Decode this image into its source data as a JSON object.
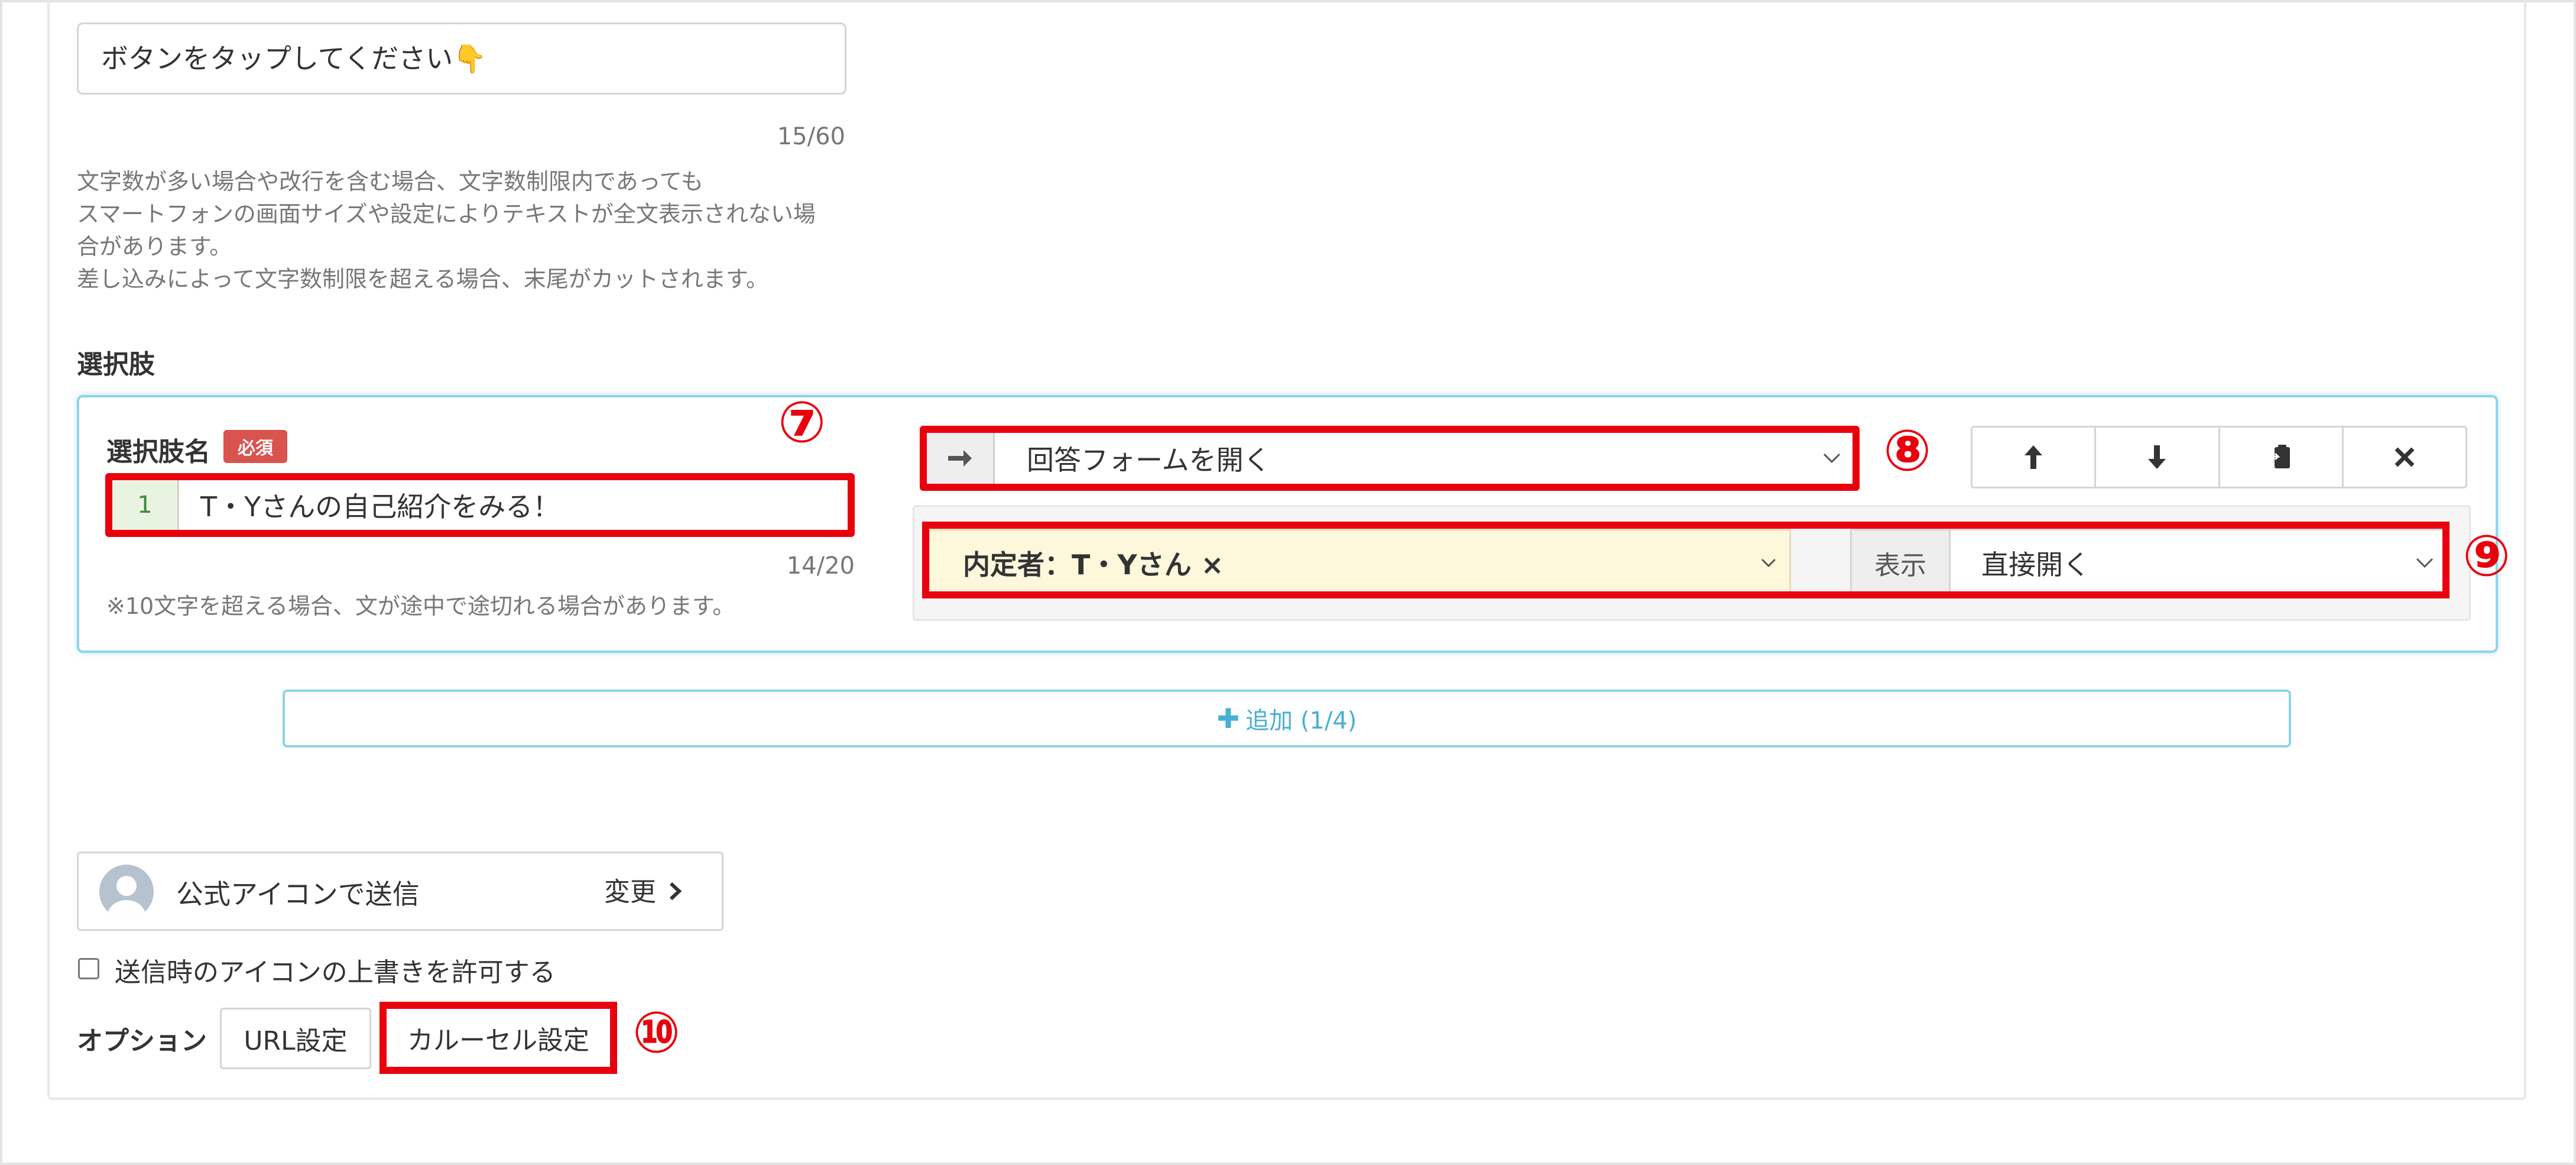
{
  "message": {
    "value": "ボタンをタップしてください👇",
    "counter": "15/60"
  },
  "help_lines": [
    "文字数が多い場合や改行を含む場合、文字数制限内であっても",
    "スマートフォンの画面サイズや設定によりテキストが全文表示されない場",
    "合があります。",
    "差し込みによって文字数制限を超える場合、末尾がカットされます。"
  ],
  "choices_section": {
    "title": "選択肢",
    "name_label": "選択肢名",
    "required_badge": "必須",
    "choice": {
      "number": "1",
      "value": "T・Yさんの自己紹介をみる！",
      "counter": "14/20"
    },
    "note": "※10文字を超える場合、文が途中で途切れる場合があります。",
    "action": {
      "arrow_icon": "arrow-right-icon",
      "selected": "回答フォームを開く"
    },
    "controls": {
      "up": "arrow-up-icon",
      "down": "arrow-down-icon",
      "copy": "copy-icon",
      "delete": "close-icon"
    },
    "tag": {
      "selected": "内定者：T・Yさん ×"
    },
    "display": {
      "addon": "表示",
      "selected": "直接開く"
    },
    "add_button": "追加 (1/4)"
  },
  "annotations": {
    "n7": "⑦",
    "n8": "⑧",
    "n9": "⑨",
    "n10": "⑩",
    "color": "#e8000d"
  },
  "sender": {
    "label": "公式アイコンで送信",
    "change": "変更"
  },
  "override_checkbox": {
    "label": "送信時のアイコンの上書きを許可する",
    "checked": false
  },
  "options": {
    "label": "オプション",
    "url_button": "URL設定",
    "carousel_button": "カルーセル設定"
  }
}
